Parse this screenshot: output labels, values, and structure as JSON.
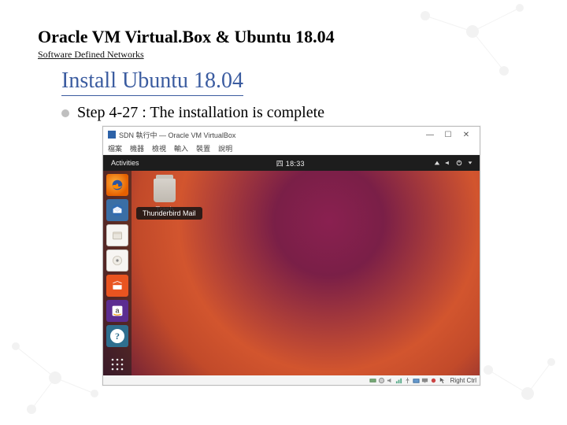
{
  "slide": {
    "title": "Oracle VM Virtual.Box & Ubuntu 18.04",
    "subtitle": "Software Defined Networks",
    "heading": "Install Ubuntu 18.04",
    "step_text": "Step 4-27 : The installation is complete"
  },
  "virtualbox": {
    "window_title": "SDN 執行中 — Oracle VM VirtualBox",
    "window_controls": {
      "minimize": "—",
      "maximize": "☐",
      "close": "✕"
    },
    "menu": [
      "檔案",
      "機器",
      "檢視",
      "輸入",
      "裝置",
      "說明"
    ],
    "statusbar_host_key": "Right Ctrl"
  },
  "ubuntu": {
    "topbar": {
      "activities": "Activities",
      "clock": "四 18:33",
      "tray_icons": [
        "network-icon",
        "volume-icon",
        "power-icon",
        "dropdown-icon"
      ]
    },
    "dock": [
      {
        "name": "firefox-icon",
        "label": "Firefox"
      },
      {
        "name": "thunderbird-icon",
        "label": "Thunderbird Mail"
      },
      {
        "name": "files-icon",
        "label": "Files"
      },
      {
        "name": "rhythmbox-icon",
        "label": "Rhythmbox"
      },
      {
        "name": "software-icon",
        "label": "Ubuntu Software"
      },
      {
        "name": "amazon-icon",
        "label": "Amazon"
      },
      {
        "name": "help-icon",
        "label": "Help"
      }
    ],
    "apps_grid_label": "Show Applications",
    "desktop": {
      "trash_label": "Trash"
    },
    "tooltip": "Thunderbird Mail"
  },
  "colors": {
    "heading": "#3b5ca0",
    "ubuntu_accent": "#e95420",
    "gnome_bar": "#1d1d1d"
  }
}
